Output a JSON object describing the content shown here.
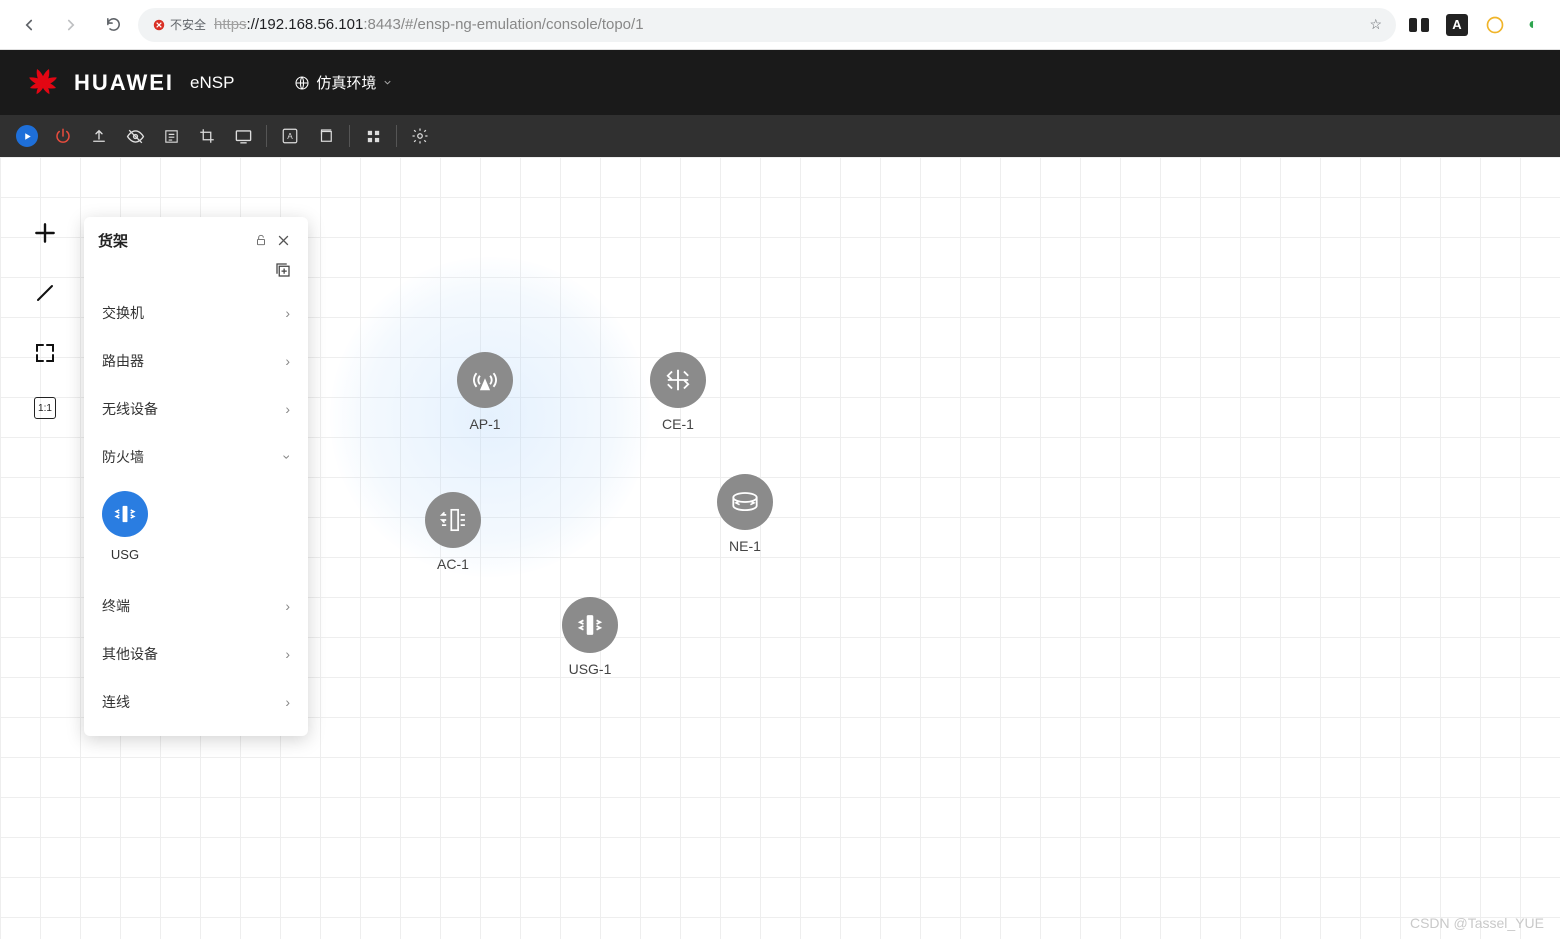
{
  "browser": {
    "insecure_label": "不安全",
    "url_https": "https",
    "url_host": "://192.168.56.101",
    "url_port": ":8443",
    "url_path": "/#/ensp-ng-emulation/console/topo/1"
  },
  "header": {
    "brand": "HUAWEI",
    "subbrand": "eNSP",
    "env_label": "仿真环境"
  },
  "panel": {
    "title": "货架",
    "categories": {
      "switch": "交换机",
      "router": "路由器",
      "wireless": "无线设备",
      "firewall": "防火墙",
      "terminal": "终端",
      "other": "其他设备",
      "link": "连线"
    },
    "firewall_item": "USG",
    "scale_label": "1:1"
  },
  "nodes": {
    "ap": "AP-1",
    "ce": "CE-1",
    "ac": "AC-1",
    "ne": "NE-1",
    "usg": "USG-1"
  },
  "watermark": "CSDN @Tassel_YUE"
}
